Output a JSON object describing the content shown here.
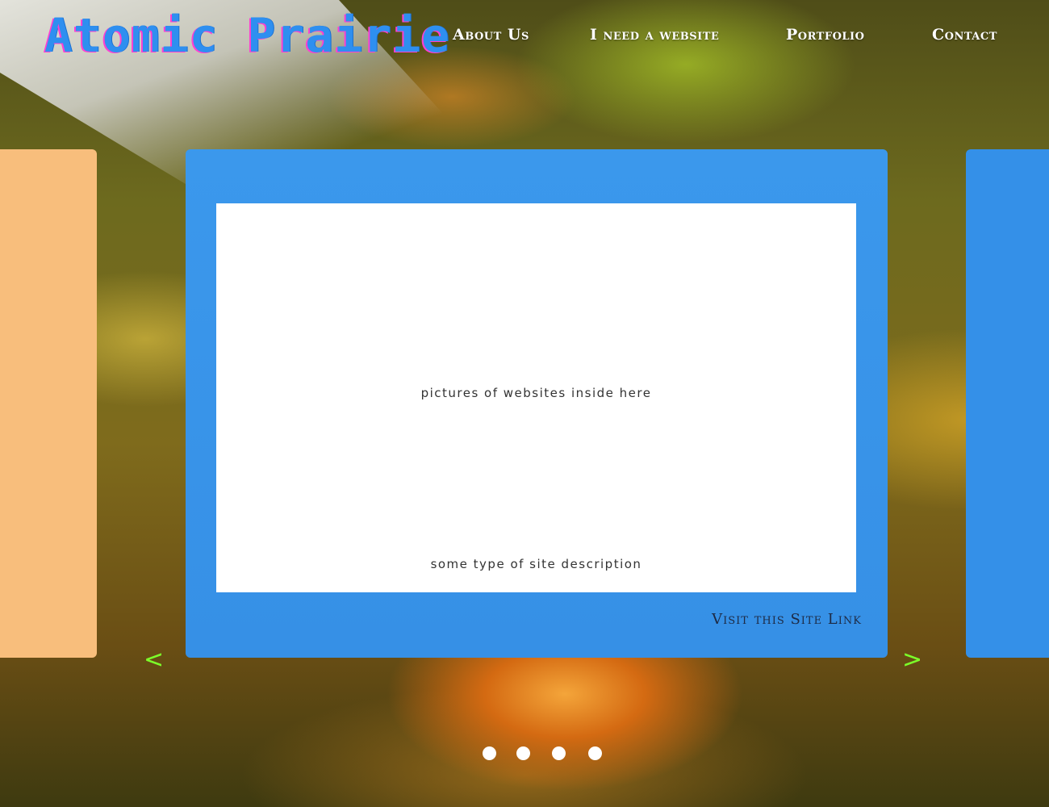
{
  "brand": {
    "logo_text": "Atomic Prairie"
  },
  "nav": {
    "items": [
      {
        "label": "About Us"
      },
      {
        "label": "I need a website"
      },
      {
        "label": "Portfolio"
      },
      {
        "label": "Contact"
      }
    ]
  },
  "carousel": {
    "card": {
      "image_placeholder": "pictures of websites inside here",
      "description": "some type of site description",
      "link_label": "Visit this Site Link"
    },
    "prev_label": "<",
    "next_label": ">",
    "dot_count": 4
  },
  "colors": {
    "logo": "#2e8ff0",
    "card_blue": "#3690e6",
    "side_panel_left": "#f8be7c",
    "arrow": "#7cff2a"
  }
}
